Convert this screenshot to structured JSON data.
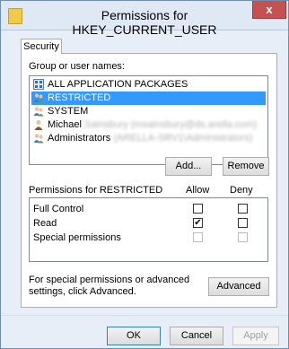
{
  "window": {
    "title": "Permissions for HKEY_CURRENT_USER",
    "close_label": "x"
  },
  "tabs": [
    {
      "label": "Security"
    }
  ],
  "group_label": "Group or user names:",
  "principals": [
    {
      "label": "ALL APPLICATION PACKAGES",
      "detail": "",
      "icon": "app-packages-icon",
      "selected": false
    },
    {
      "label": "RESTRICTED",
      "detail": "",
      "icon": "group-icon",
      "selected": true
    },
    {
      "label": "SYSTEM",
      "detail": "",
      "icon": "group-icon",
      "selected": false
    },
    {
      "label": "Michael",
      "detail": "Sainsbury (msainsbury@ds.arella.com)",
      "icon": "user-icon",
      "selected": false
    },
    {
      "label": "Administrators",
      "detail": "(ARELLA-SRV1\\Administrators)",
      "icon": "group-icon",
      "selected": false
    }
  ],
  "buttons": {
    "add": "Add...",
    "remove": "Remove",
    "advanced": "Advanced",
    "ok": "OK",
    "cancel": "Cancel",
    "apply": "Apply"
  },
  "permissions": {
    "header": "Permissions for RESTRICTED",
    "allow_header": "Allow",
    "deny_header": "Deny",
    "rows": [
      {
        "name": "Full Control",
        "allow": false,
        "deny": false,
        "enabled": true
      },
      {
        "name": "Read",
        "allow": true,
        "deny": false,
        "enabled": true
      },
      {
        "name": "Special permissions",
        "allow": false,
        "deny": false,
        "enabled": false
      }
    ]
  },
  "advanced_hint": "For special permissions or advanced settings, click Advanced."
}
